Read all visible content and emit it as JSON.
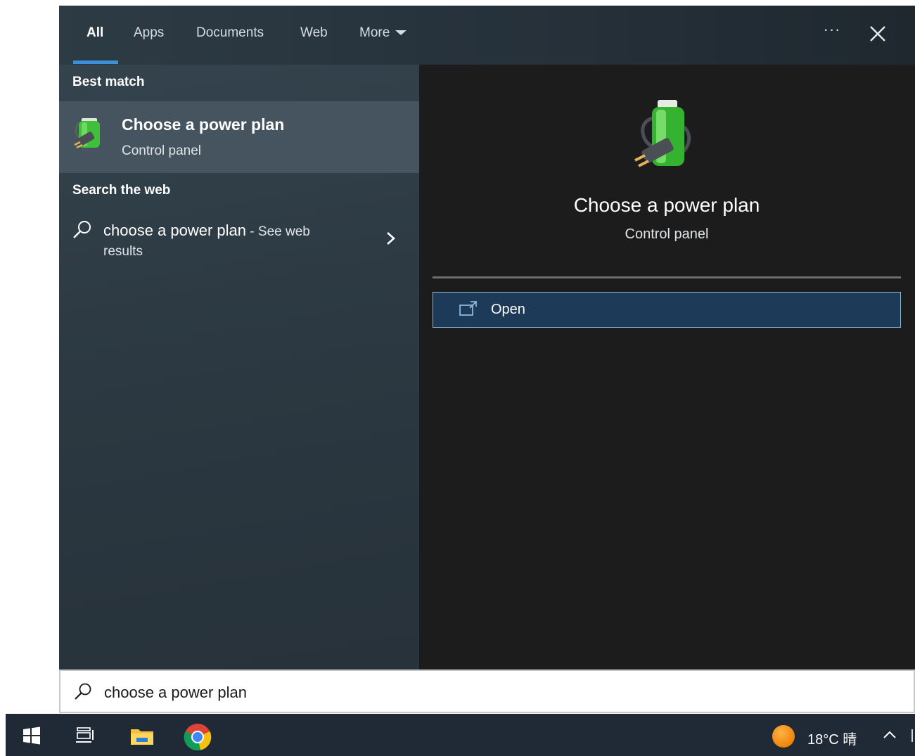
{
  "tabs": [
    {
      "label": "All",
      "active": true
    },
    {
      "label": "Apps",
      "active": false
    },
    {
      "label": "Documents",
      "active": false
    },
    {
      "label": "Web",
      "active": false
    },
    {
      "label": "More",
      "active": false
    }
  ],
  "header_actions": {
    "more_options": "···"
  },
  "left_pane": {
    "best_match_heading": "Best match",
    "best_match": {
      "title": "Choose a power plan",
      "subtitle": "Control panel",
      "icon": "power-plan-battery-icon"
    },
    "search_web_heading": "Search the web",
    "web_result": {
      "query": "choose a power plan",
      "suffix": " - See web",
      "suffix_continued": "results"
    }
  },
  "detail": {
    "title": "Choose a power plan",
    "subtitle": "Control panel",
    "actions": [
      {
        "label": "Open",
        "icon": "open-external-icon"
      }
    ]
  },
  "searchbox": {
    "value": "choose a power plan"
  },
  "taskbar": {
    "items": [
      "windows-start-icon",
      "task-view-icon",
      "file-explorer-icon",
      "chrome-icon"
    ],
    "weather": {
      "temp": "18°C",
      "condition": "晴"
    }
  },
  "colors": {
    "accent": "#3a8fd6",
    "open_button_bg": "#1d3b58",
    "selected_item_bg": "#45545e",
    "taskbar_bg": "#1f2a36"
  }
}
